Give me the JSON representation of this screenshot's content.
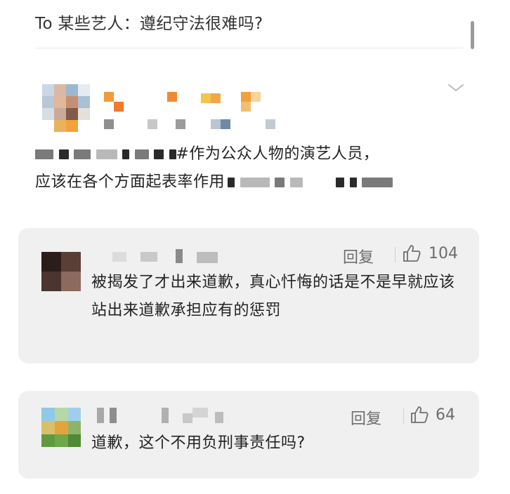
{
  "post": {
    "title": "To 某些艺人：遵纪守法很难吗?",
    "body_line1": "#作为公众人物的演艺人员，",
    "body_line2": "应该在各个方面起表率作用"
  },
  "comments": [
    {
      "reply_label": "回复",
      "likes": "104",
      "text": "被揭发了才出来道歉，真心忏悔的话是不是早就应该站出来道歉承担应有的惩罚"
    },
    {
      "reply_label": "回复",
      "likes": "64",
      "text": "道歉，这个不用负刑事责任吗?"
    }
  ],
  "icons": {
    "expand": "chevron-down-icon",
    "like": "thumbs-up-icon"
  },
  "colors": {
    "card_background": "#f0f0f0",
    "muted_text": "#6d6d6d",
    "body_text": "#222222"
  }
}
